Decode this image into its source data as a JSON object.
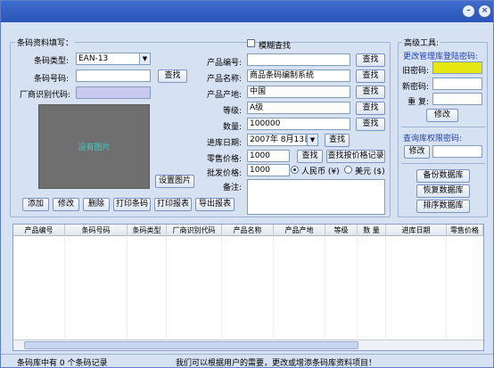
{
  "window": {
    "title": "",
    "minimize_glyph": "–",
    "close_glyph": "×"
  },
  "barcode_group": {
    "title": "条码资料填写：",
    "barcode_type_label": "条码类型:",
    "barcode_type_value": "EAN-13",
    "barcode_no_label": "条码号码:",
    "barcode_no_value": "",
    "find_label": "查找",
    "vendor_code_label": "厂商识别代码:",
    "vendor_code_value": "",
    "photo_text": "没有图片",
    "set_photo_label": "设置图片"
  },
  "product": {
    "fuzzy_label": "模糊查找",
    "fuzzy_checked": false,
    "code_label": "产品编号:",
    "code_value": "",
    "name_label": "产品名称:",
    "name_value": "商品条码编制系统",
    "origin_label": "产品产地:",
    "origin_value": "中国",
    "grade_label": "等级:",
    "grade_value": "A级",
    "qty_label": "数量:",
    "qty_value": "100000",
    "date_label": "进库日期:",
    "date_value": "2007年 8月13日",
    "retail_label": "零售价格:",
    "retail_value": "1000",
    "wholesale_label": "批发价格:",
    "wholesale_value": "1000",
    "note_label": "备注:",
    "note_value": "",
    "find_label": "查找",
    "find_by_price_label": "查找按价格记录",
    "currency_rmb_label": "人民币 (¥)",
    "currency_usd_label": "美元 ($)",
    "currency_selected": "rmb"
  },
  "actions": {
    "add": "添加",
    "edit": "修改",
    "delete": "删除",
    "print_barcode": "打印条码",
    "print_report": "打印报表",
    "export_report": "导出报表"
  },
  "advanced": {
    "title": "高级工具:",
    "change_admin_pwd_title": "更改管理库登陆密码:",
    "old_pwd_label": "旧密码:",
    "new_pwd_label": "新密码:",
    "repeat_pwd_label": "重  复:",
    "edit_label": "修改",
    "query_pwd_title": "查询库权限密码:",
    "query_edit_label": "修改",
    "backup_label": "备份数据库",
    "restore_label": "恢复数据库",
    "sort_label": "排序数据库"
  },
  "grid": {
    "columns": [
      "产品编号",
      "条码号码",
      "条码类型",
      "厂商识别代码",
      "产品名称",
      "产品产地",
      "等级",
      "数 量",
      "进库日期",
      "零售价格"
    ]
  },
  "status": {
    "left": "条码库中有  0 个条码记录",
    "right": "我们可以根据用户的需要，更改或增添条码库资料项目！"
  },
  "colors": {
    "titlebar": "#2b55b8",
    "window_bg": "#d6e1f2",
    "highlight_input": "#e6e610",
    "blue_text": "#1d3fb3"
  }
}
